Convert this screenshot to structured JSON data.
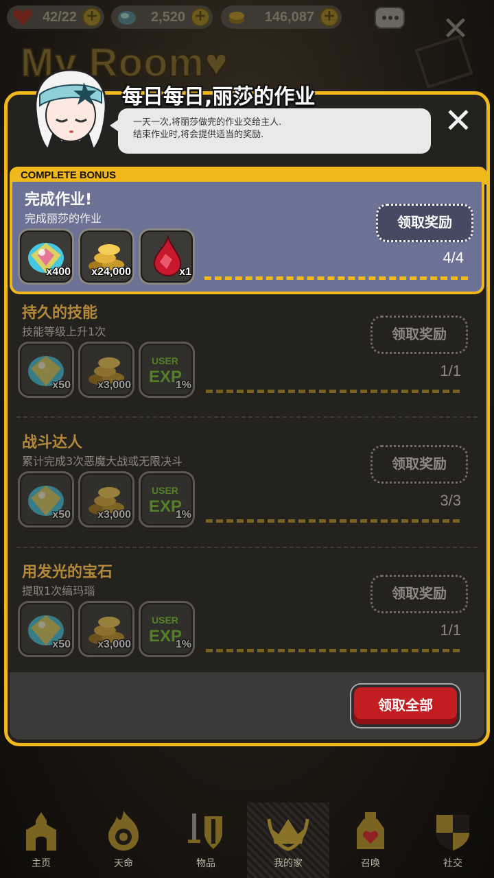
{
  "resources": {
    "hearts": "42/22",
    "gems": "2,520",
    "gold": "146,087"
  },
  "background": {
    "title": "My Room♥"
  },
  "dialog": {
    "title": "每日每日,丽莎的作业",
    "speech_line1": "一天一次,将丽莎做完的作业交给主人.",
    "speech_line2": "结束作业时,将会提供适当的奖励.",
    "bonus_tab": "COMPLETE BONUS",
    "claim_all": "领取全部"
  },
  "missions": [
    {
      "title": "完成作业!",
      "desc": "完成丽莎的作业",
      "claim": "领取奖励",
      "progress": "4/4",
      "rewards": [
        {
          "icon": "rainbow-gem-icon",
          "qty": "x400"
        },
        {
          "icon": "gold-coins-icon",
          "qty": "x24,000"
        },
        {
          "icon": "red-crystal-icon",
          "qty": "x1"
        }
      ]
    },
    {
      "title": "持久的技能",
      "desc": "技能等级上升1次",
      "claim": "领取奖励",
      "progress": "1/1",
      "rewards": [
        {
          "icon": "rainbow-gem-icon",
          "qty": "x50"
        },
        {
          "icon": "gold-coins-icon",
          "qty": "x3,000"
        },
        {
          "icon": "user-exp-icon",
          "qty": "1%"
        }
      ]
    },
    {
      "title": "战斗达人",
      "desc": "累计完成3次恶魔大战或无限决斗",
      "claim": "领取奖励",
      "progress": "3/3",
      "rewards": [
        {
          "icon": "rainbow-gem-icon",
          "qty": "x50"
        },
        {
          "icon": "gold-coins-icon",
          "qty": "x3,000"
        },
        {
          "icon": "user-exp-icon",
          "qty": "1%"
        }
      ]
    },
    {
      "title": "用发光的宝石",
      "desc": "提取1次缟玛瑙",
      "claim": "领取奖励",
      "progress": "1/1",
      "rewards": [
        {
          "icon": "rainbow-gem-icon",
          "qty": "x50"
        },
        {
          "icon": "gold-coins-icon",
          "qty": "x3,000"
        },
        {
          "icon": "user-exp-icon",
          "qty": "1%"
        }
      ]
    }
  ],
  "nav": [
    {
      "label": "主页",
      "icon": "home-icon"
    },
    {
      "label": "天命",
      "icon": "fate-flame-icon"
    },
    {
      "label": "物品",
      "icon": "items-sword-shield-icon"
    },
    {
      "label": "我的家",
      "icon": "my-home-crown-icon",
      "active": true
    },
    {
      "label": "召唤",
      "icon": "summon-potion-icon"
    },
    {
      "label": "社交",
      "icon": "social-shield-icon"
    }
  ],
  "colors": {
    "accent_gold": "#f0b81a",
    "highlight_row": "#6b7295",
    "claim_all_red": "#c21d20"
  }
}
